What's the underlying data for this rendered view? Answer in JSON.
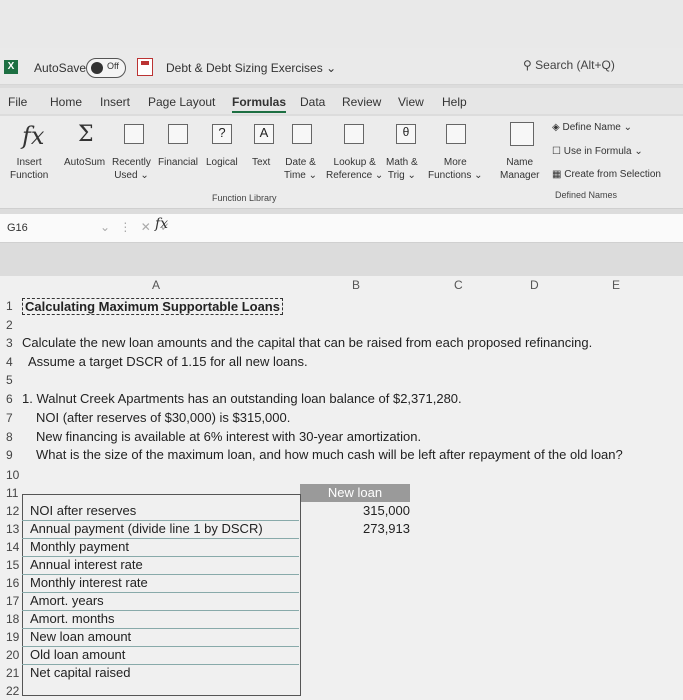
{
  "app": {
    "autosave_label": "AutoSave",
    "autosave_state": "Off",
    "doc_title": "Debt & Debt Sizing Exercises",
    "search_placeholder": "Search (Alt+Q)"
  },
  "menu": [
    "File",
    "Home",
    "Insert",
    "Page Layout",
    "Formulas",
    "Data",
    "Review",
    "View",
    "Help"
  ],
  "ribbon": {
    "insert_function": [
      "Insert",
      "Function"
    ],
    "autosum": "AutoSum",
    "recently_used": [
      "Recently",
      "Used"
    ],
    "financial": "Financial",
    "logical": "Logical",
    "text": "Text",
    "date_time": [
      "Date &",
      "Time"
    ],
    "lookup": [
      "Lookup &",
      "Reference"
    ],
    "math": [
      "Math &",
      "Trig"
    ],
    "more": [
      "More",
      "Functions"
    ],
    "function_library": "Function Library",
    "name_manager": [
      "Name",
      "Manager"
    ],
    "define_name": "Define Name",
    "use_in_formula": "Use in Formula",
    "create_from_selection": "Create from Selection",
    "defined_names": "Defined Names"
  },
  "formula_bar": {
    "name_box": "G16",
    "fx": "fx"
  },
  "columns": [
    "A",
    "B",
    "C",
    "D",
    "E"
  ],
  "rows": {
    "1": "Calculating Maximum Supportable Loans",
    "3": "Calculate the new loan amounts and the capital that can be raised from each proposed refinancing.",
    "4": "Assume a target DSCR of 1.15 for all new loans.",
    "6": "1. Walnut Creek Apartments has an outstanding loan balance of $2,371,280.",
    "7": "NOI (after reserves of $30,000) is $315,000.",
    "8": "New financing is available at 6% interest with 30-year amortization.",
    "9": "What is the size of the maximum loan, and how much cash will be left after repayment of the old loan?"
  },
  "table": {
    "header": "New loan",
    "labels": [
      "NOI after reserves",
      "Annual payment (divide line 1 by DSCR)",
      "Monthly payment",
      "Annual interest rate",
      "Monthly interest rate",
      "Amort. years",
      "Amort. months",
      "New loan amount",
      "Old loan amount",
      "Net capital raised"
    ],
    "values": [
      "315,000",
      "273,913",
      "",
      "",
      "",
      "",
      "",
      "",
      "",
      ""
    ]
  },
  "row_numbers": [
    "1",
    "2",
    "3",
    "4",
    "5",
    "6",
    "7",
    "8",
    "9",
    "10",
    "11",
    "12",
    "13",
    "14",
    "15",
    "16",
    "17",
    "18",
    "19",
    "20",
    "21",
    "22"
  ]
}
